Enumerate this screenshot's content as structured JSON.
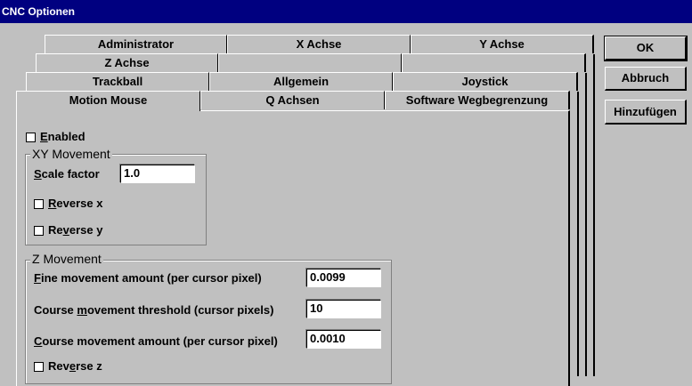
{
  "window": {
    "title": "CNC Optionen"
  },
  "tabs": {
    "row1": [
      "Administrator",
      "X Achse",
      "Y Achse"
    ],
    "row2": [
      "Z Achse",
      "",
      ""
    ],
    "row3": [
      "Trackball",
      "Allgemein",
      "Joystick"
    ],
    "row4": [
      "Motion Mouse",
      "Q Achsen",
      "Software Wegbegrenzung"
    ]
  },
  "buttons": {
    "ok": "OK",
    "cancel": "Abbruch",
    "add": "Hinzufügen"
  },
  "enabled": {
    "accel": "E",
    "rest": "nabled",
    "checked": false
  },
  "xy": {
    "title": "XY Movement",
    "scale_accel": "S",
    "scale_rest": "cale factor",
    "scale_value": "1.0",
    "rev_x_accel": "R",
    "rev_x_rest": "everse x",
    "rev_x_checked": false,
    "rev_y_pre": "Re",
    "rev_y_accel": "v",
    "rev_y_rest": "erse y",
    "rev_y_checked": false
  },
  "z": {
    "title": "Z Movement",
    "fine_accel": "F",
    "fine_rest": "ine movement amount (per cursor pixel)",
    "fine_value": "0.0099",
    "thresh_pre": "Course ",
    "thresh_accel": "m",
    "thresh_rest": "ovement threshold (cursor pixels)",
    "thresh_value": "10",
    "amount_accel": "C",
    "amount_rest": "ourse movement amount (per cursor pixel)",
    "amount_value": "0.0010",
    "rev_z_pre": "Rev",
    "rev_z_accel": "e",
    "rev_z_rest": "rse z",
    "rev_z_checked": false
  }
}
